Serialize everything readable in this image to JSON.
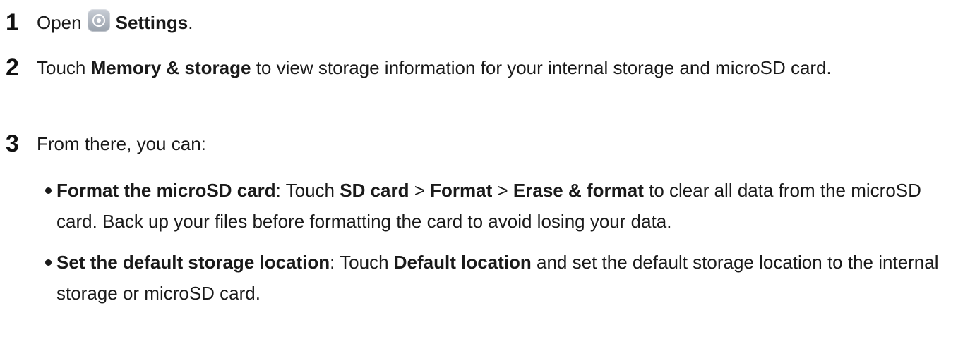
{
  "steps": [
    {
      "num": "1",
      "open": "Open",
      "settings_icon": "settings-icon",
      "settings": "Settings",
      "end": "."
    },
    {
      "num": "2",
      "touch": "Touch",
      "memory": "Memory & storage",
      "rest": "to view storage information for your internal storage and microSD card."
    },
    {
      "num": "3",
      "text": "From there, you can:",
      "bullets": [
        {
          "lead": "Format the microSD card",
          "colon": ": Touch ",
          "sd_card": "SD card",
          "gt1": " > ",
          "format": "Format",
          "gt2": " > ",
          "erase": "Erase & format",
          "rest": " to clear all data from the microSD card. Back up your files before formatting the card to avoid losing your data."
        },
        {
          "lead": "Set the default storage location",
          "colon": ": Touch ",
          "default_location": "Default location",
          "rest": " and set the default storage location to the internal storage or microSD card."
        }
      ]
    }
  ]
}
